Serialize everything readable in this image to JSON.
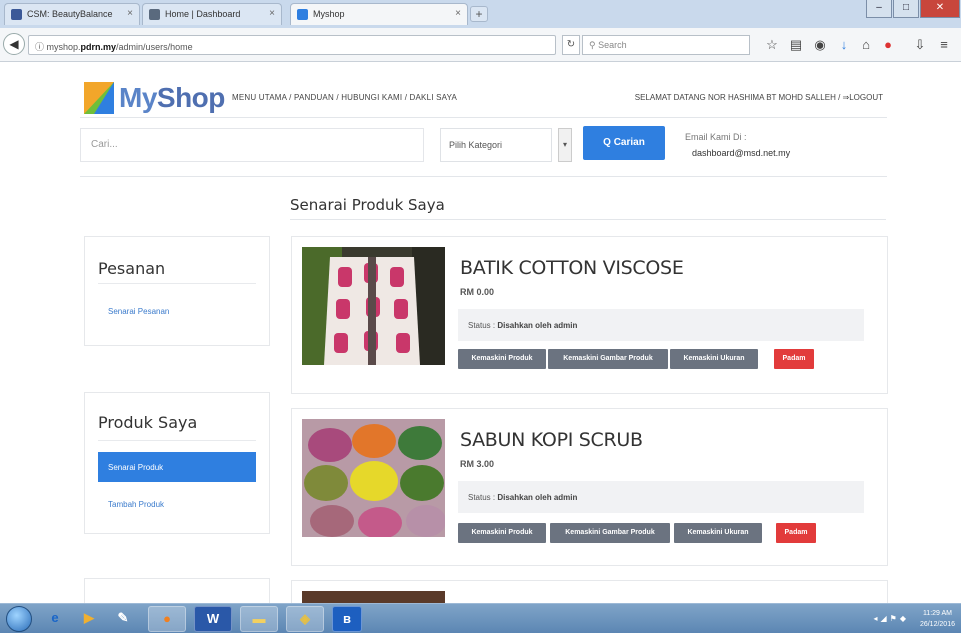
{
  "browser": {
    "tabs": [
      {
        "label": "CSM: BeautyBalance"
      },
      {
        "label": "Home | Dashboard"
      },
      {
        "label": "Myshop"
      }
    ],
    "url_prefix": "myshop.",
    "url_domain": "pdrn.my",
    "url_path": "/admin/users/home",
    "search_placeholder": "Search"
  },
  "site": {
    "logo_my": "My",
    "logo_shop": "Shop",
    "nav": "MENU UTAMA / PANDUAN / HUBUNGI KAMI / DAKLI SAYA",
    "user_greeting": "SELAMAT DATANG NOR HASHIMA BT MOHD SALLEH / ⇒LOGOUT",
    "search_placeholder": "Cari...",
    "category_placeholder": "Pilih Kategori",
    "search_button": "Q Carian",
    "contact_label": "Email Kami Di :",
    "contact_email": "dashboard@msd.net.my"
  },
  "page": {
    "title": "Senarai Produk Saya"
  },
  "sidebar": {
    "orders": {
      "title": "Pesanan",
      "link": "Senarai Pesanan"
    },
    "products": {
      "title": "Produk Saya",
      "links": [
        "Senarai Produk",
        "Tambah Produk"
      ]
    }
  },
  "products": [
    {
      "name": "BATIK COTTON VISCOSE",
      "price": "RM 0.00",
      "status_label": "Status :",
      "status_value": "Disahkan oleh admin",
      "buttons": [
        "Kemaskini Produk",
        "Kemaskini Gambar Produk",
        "Kemaskini Ukuran",
        "Padam"
      ]
    },
    {
      "name": "SABUN KOPI SCRUB",
      "price": "RM 3.00",
      "status_label": "Status :",
      "status_value": "Disahkan oleh admin",
      "buttons": [
        "Kemaskini Produk",
        "Kemaskini Gambar Produk",
        "Kemaskini Ukuran",
        "Padam"
      ]
    }
  ],
  "taskbar": {
    "clock_time": "11:29 AM",
    "clock_date": "26/12/2016"
  },
  "colors": {
    "primary": "#2f7fe0",
    "danger": "#e23b3b",
    "button_gray": "#6b7380"
  }
}
